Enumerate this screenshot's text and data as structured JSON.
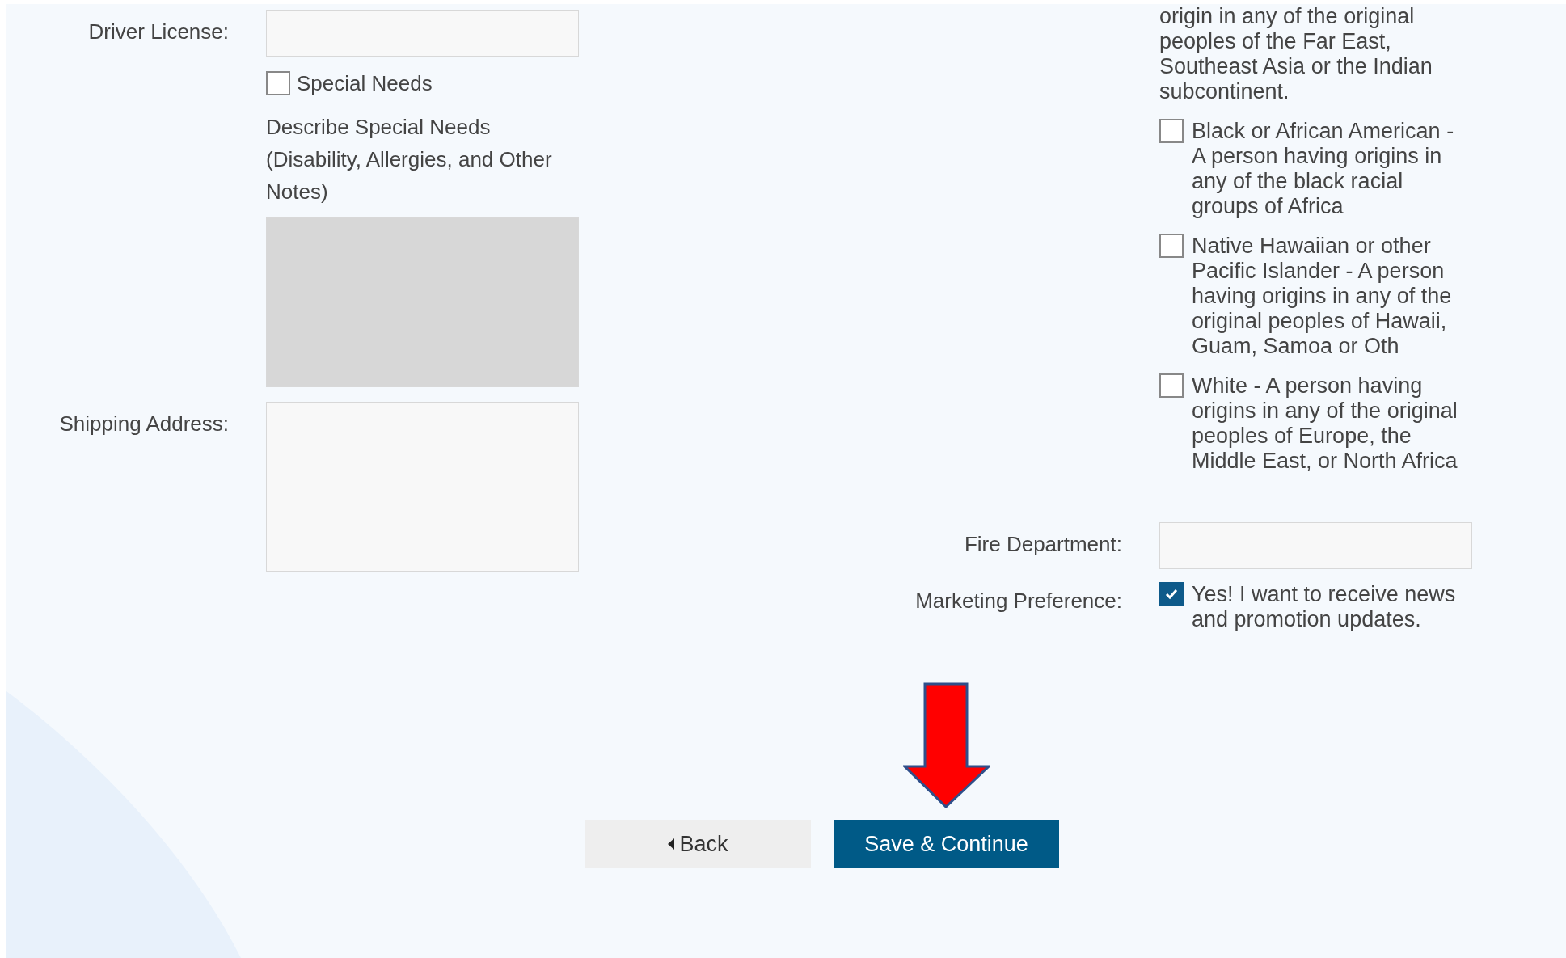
{
  "left_fields": [
    {
      "kind": "text",
      "label": "Driver License:"
    },
    {
      "kind": "checkbox",
      "label": "Special Needs",
      "checked": false
    },
    {
      "kind": "textarea",
      "label": "Describe Special Needs (Disability, Allergies, and Other Notes)",
      "disabled": true
    },
    {
      "kind": "address",
      "label": "Shipping Address:",
      "disabled": false
    }
  ],
  "race_fragment": "origin in any of the original peoples of the Far East, Southeast Asia or the Indian subcontinent.",
  "race_options": [
    {
      "label": "Black or African American - A person having origins in any of the black racial groups of Africa",
      "checked": false
    },
    {
      "label": "Native Hawaiian or other Pacific Islander - A person having origins in any of the original peoples of Hawaii, Guam, Samoa or Oth",
      "checked": false
    },
    {
      "label": "White - A person having origins in any of the original peoples of Europe, the Middle East, or North Africa",
      "checked": false
    }
  ],
  "fire_department": {
    "label": "Fire Department:"
  },
  "marketing": {
    "label": "Marketing Preference:",
    "option": "Yes! I want to receive news and promotion updates.",
    "checked": true
  },
  "buttons": {
    "back": "Back",
    "save": "Save & Continue"
  }
}
